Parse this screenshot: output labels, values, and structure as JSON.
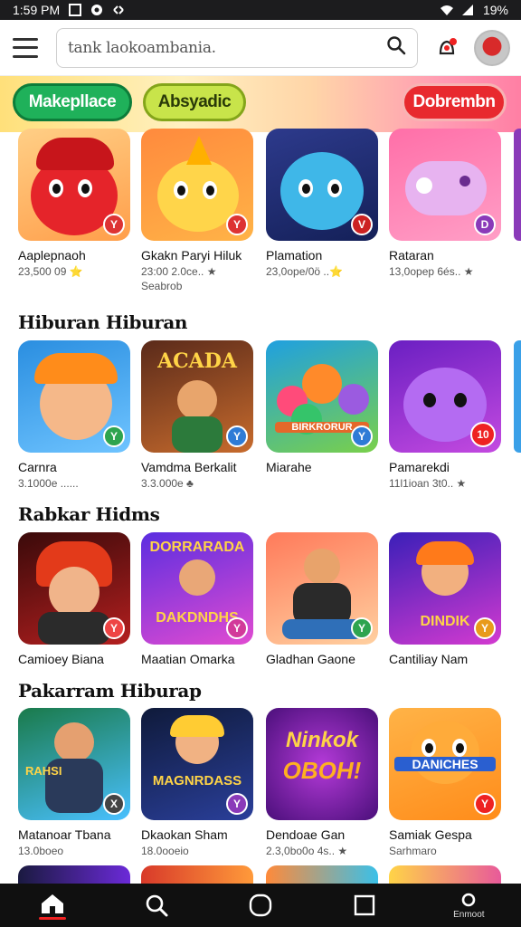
{
  "status_bar": {
    "time": "1:59 PM",
    "battery": "19%"
  },
  "header": {
    "search_value": "tank laokoambania."
  },
  "banner": {
    "chips": [
      {
        "label": "Makepllace",
        "color": "#1fb15a"
      },
      {
        "label": "Absyadic",
        "color": "#c8e44a"
      },
      {
        "label": "Dobrembn",
        "color": "#e8292e"
      }
    ]
  },
  "top_row": {
    "items": [
      {
        "title": "Aaplepnaoh",
        "sub": "23,500 09 ⭐",
        "sub2": ""
      },
      {
        "title": "Gkakn Paryi Hiluk",
        "sub": "23:00 2.0ce.. ★",
        "sub2": "Seabrob"
      },
      {
        "title": "Plamation",
        "sub": "23,0ope/0ö ..⭐",
        "sub2": ""
      },
      {
        "title": "Rataran",
        "sub": "13,0opep 6és.. ★",
        "sub2": ""
      }
    ]
  },
  "sections": [
    {
      "title": "Hiburan Hiburan",
      "items": [
        {
          "title": "Carnra",
          "sub": "3.1000e ......",
          "badge": "Y"
        },
        {
          "title": "Vamdma Berkalit",
          "sub": "3.3.000e ♣",
          "badge": "Y"
        },
        {
          "title": "Miarahe",
          "sub": "",
          "badge": "Y"
        },
        {
          "title": "Pamarekdi",
          "sub": "11l1ioan 3t0.. ★",
          "badge": "10"
        }
      ]
    },
    {
      "title": "Rabkar Hidms",
      "items": [
        {
          "title": "Camioey Biana",
          "sub": "",
          "badge": "Y"
        },
        {
          "title": "Maatian Omarka",
          "sub": "",
          "badge": "Y"
        },
        {
          "title": "Gladhan Gaone",
          "sub": "",
          "badge": "Y"
        },
        {
          "title": "Cantiliay Nam",
          "sub": "",
          "badge": "Y"
        }
      ]
    },
    {
      "title": "Pakarram Hiburap",
      "items": [
        {
          "title": "Matanoar Tbana",
          "sub": "13.0boeo",
          "badge": "X"
        },
        {
          "title": "Dkaokan Sham",
          "sub": "18.0ooeio",
          "badge": "Y"
        },
        {
          "title": "Dendoae Gan",
          "sub": "2.3,0bo0o 4s.. ★",
          "badge": ""
        },
        {
          "title": "Samiak Gespa",
          "sub": "Sarhmaro",
          "badge": "Y"
        }
      ]
    }
  ],
  "thumb_text": {
    "r1c2": "ACADA",
    "r1c3": "BIRKRORUR",
    "r2c2a": "DORRARADA",
    "r2c2b": "DAKDNDHS",
    "r2c4": "DINDIK",
    "r3c1": "RAHSI",
    "r3c2": "MAGNRDASS",
    "r3c3a": "Ninkok",
    "r3c3b": "OBOH!",
    "r3c4": "DANICHES"
  },
  "bottom_nav": {
    "last_label": "Enmoot"
  },
  "colors": {
    "accent_red": "#e22222",
    "nav_bg": "#101010"
  }
}
